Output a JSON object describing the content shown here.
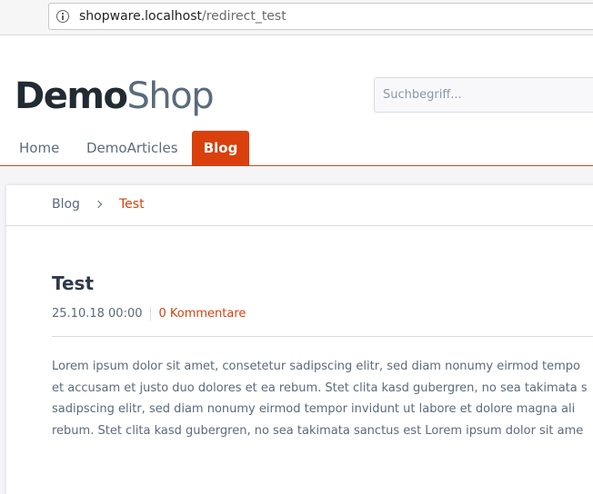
{
  "browser": {
    "url_host": "shopware.localhost",
    "url_path": "/redirect_test"
  },
  "header": {
    "logo_demo": "Demo",
    "logo_shop": "Shop",
    "search_placeholder": "Suchbegriff..."
  },
  "nav": {
    "items": [
      {
        "label": "Home"
      },
      {
        "label": "DemoArticles"
      },
      {
        "label": "Blog",
        "active": true
      }
    ]
  },
  "breadcrumb": {
    "items": [
      "Blog",
      "Test"
    ]
  },
  "post": {
    "title": "Test",
    "date": "25.10.18 00:00",
    "comments": "0 Kommentare",
    "body_lines": [
      "Lorem ipsum dolor sit amet, consetetur sadipscing elitr, sed diam nonumy eirmod tempo",
      "et accusam et justo duo dolores et ea rebum. Stet clita kasd gubergren, no sea takimata s",
      "sadipscing elitr, sed diam nonumy eirmod tempor invidunt ut labore et dolore magna ali",
      "rebum. Stet clita kasd gubergren, no sea takimata sanctus est Lorem ipsum dolor sit ame"
    ]
  },
  "colors": {
    "accent": "#d9400b",
    "text": "#5a6b7b",
    "heading": "#2f3a4a"
  },
  "icons": {
    "address_bar": "info-icon",
    "breadcrumb_separator": "chevron-right-icon"
  }
}
